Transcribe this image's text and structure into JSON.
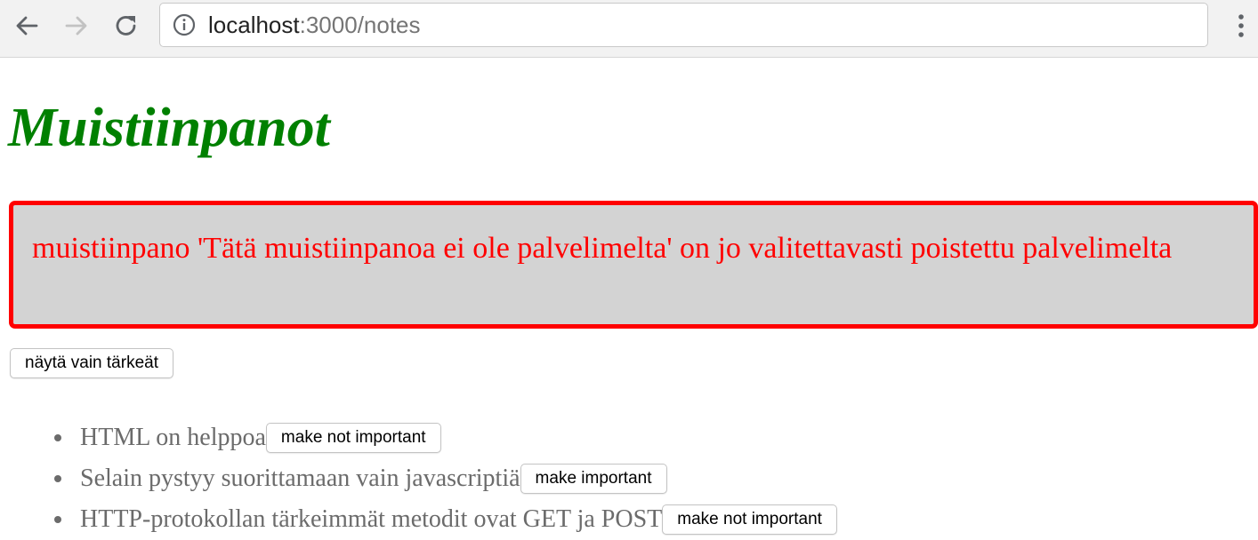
{
  "browser": {
    "url_host": "localhost",
    "url_rest": ":3000/notes",
    "icons": {
      "back": "back-arrow-icon",
      "forward": "forward-arrow-icon",
      "reload": "reload-icon",
      "info": "info-icon",
      "menu": "kebab-menu-icon"
    }
  },
  "page": {
    "title": "Muistiinpanot",
    "error_message": "muistiinpano 'Tätä muistiinpanoa ei ole palvelimelta' on jo valitettavasti poistettu palvelimelta",
    "toggle_button_label": "näytä vain tärkeät",
    "notes": [
      {
        "content": "HTML on helppoa",
        "button_label": "make not important"
      },
      {
        "content": "Selain pystyy suorittamaan vain javascriptiä",
        "button_label": "make important"
      },
      {
        "content": "HTTP-protokollan tärkeimmät metodit ovat GET ja POST",
        "button_label": "make not important"
      }
    ]
  },
  "colors": {
    "title": "#008000",
    "error_text": "#ff0000",
    "error_border": "#ff0000",
    "error_background": "#d3d3d3",
    "note_text": "#6b6b6b"
  }
}
